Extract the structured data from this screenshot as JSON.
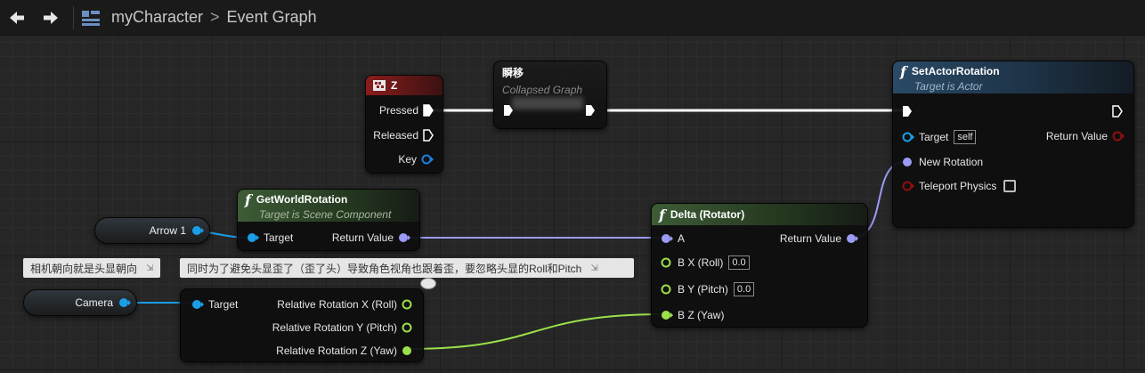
{
  "toolbar": {
    "back_icon": "back-arrow-icon",
    "forward_icon": "forward-arrow-icon",
    "blueprint_icon": "blueprint-icon",
    "breadcrumb": [
      "myCharacter",
      ">",
      "Event Graph"
    ]
  },
  "nodes": {
    "z_event": {
      "title": "Z",
      "icon": "keyboard-icon",
      "header_color": "#8b1c1c",
      "pins": {
        "pressed": "Pressed",
        "released": "Released",
        "key": "Key"
      }
    },
    "collapsed": {
      "title": "瞬移",
      "subtitle": "Collapsed Graph"
    },
    "set_actor_rotation": {
      "title": "SetActorRotation",
      "subtitle": "Target is Actor",
      "header_color": "#2a4a66",
      "pins": {
        "target": "Target",
        "target_default": "self",
        "return_value": "Return Value",
        "new_rotation": "New Rotation",
        "teleport_physics": "Teleport Physics"
      }
    },
    "get_world_rotation": {
      "title": "GetWorldRotation",
      "subtitle": "Target is Scene Component",
      "header_color": "#3d5c36",
      "pins": {
        "target": "Target",
        "return_value": "Return Value"
      }
    },
    "delta_rotator": {
      "title": "Delta (Rotator)",
      "header_color": "#3d5c36",
      "pins": {
        "a": "A",
        "return_value": "Return Value",
        "bx": "B X (Roll)",
        "bx_value": "0.0",
        "by": "B Y (Pitch)",
        "by_value": "0.0",
        "bz": "B Z (Yaw)"
      }
    },
    "break_rotation": {
      "pins": {
        "target": "Target",
        "x": "Relative Rotation X (Roll)",
        "y": "Relative Rotation Y (Pitch)",
        "z": "Relative Rotation Z (Yaw)"
      }
    },
    "arrow_var": {
      "label": "Arrow 1"
    },
    "camera_var": {
      "label": "Camera"
    }
  },
  "comments": {
    "camera_note": "相机朝向就是头显朝向",
    "rotation_note": "同时为了避免头显歪了（歪了头）导致角色视角也跟着歪，要忽略头显的Roll和Pitch"
  },
  "colors": {
    "exec": "#ffffff",
    "object_pin": "#1a9ee8",
    "rotator_pin": "#9b9bf5",
    "float_pin": "#9be04a",
    "bool_pin": "#8e0f0f"
  }
}
